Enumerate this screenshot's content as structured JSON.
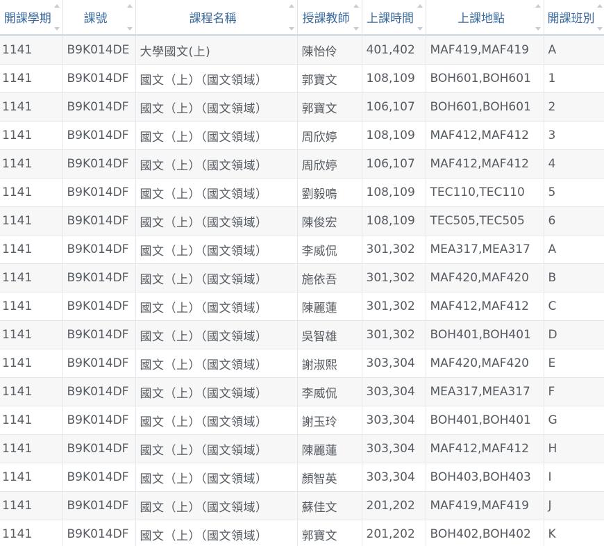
{
  "table": {
    "headers": [
      {
        "key": "semester",
        "label": "開課學期"
      },
      {
        "key": "code",
        "label": "課號"
      },
      {
        "key": "name",
        "label": "課程名稱"
      },
      {
        "key": "teacher",
        "label": "授課教師"
      },
      {
        "key": "time",
        "label": "上課時間"
      },
      {
        "key": "place",
        "label": "上課地點"
      },
      {
        "key": "class",
        "label": "開課班別"
      }
    ],
    "rows": [
      [
        "1141",
        "B9K014DE",
        "大學國文(上)",
        "陳怡伶",
        "401,402",
        "MAF419,MAF419",
        "A"
      ],
      [
        "1141",
        "B9K014DF",
        "國文（上）（國文領域）",
        "郭寶文",
        "108,109",
        "BOH601,BOH601",
        "1"
      ],
      [
        "1141",
        "B9K014DF",
        "國文（上）（國文領域）",
        "郭寶文",
        "106,107",
        "BOH601,BOH601",
        "2"
      ],
      [
        "1141",
        "B9K014DF",
        "國文（上）（國文領域）",
        "周欣婷",
        "108,109",
        "MAF412,MAF412",
        "3"
      ],
      [
        "1141",
        "B9K014DF",
        "國文（上）（國文領域）",
        "周欣婷",
        "106,107",
        "MAF412,MAF412",
        "4"
      ],
      [
        "1141",
        "B9K014DF",
        "國文（上）（國文領域）",
        "劉毅鳴",
        "108,109",
        "TEC110,TEC110",
        "5"
      ],
      [
        "1141",
        "B9K014DF",
        "國文（上）（國文領域）",
        "陳俊宏",
        "108,109",
        "TEC505,TEC505",
        "6"
      ],
      [
        "1141",
        "B9K014DF",
        "國文（上）（國文領域）",
        "李威侃",
        "301,302",
        "MEA317,MEA317",
        "A"
      ],
      [
        "1141",
        "B9K014DF",
        "國文（上）（國文領域）",
        "施依吾",
        "301,302",
        "MAF420,MAF420",
        "B"
      ],
      [
        "1141",
        "B9K014DF",
        "國文（上）（國文領域）",
        "陳麗蓮",
        "301,302",
        "MAF412,MAF412",
        "C"
      ],
      [
        "1141",
        "B9K014DF",
        "國文（上）（國文領域）",
        "吳智雄",
        "301,302",
        "BOH401,BOH401",
        "D"
      ],
      [
        "1141",
        "B9K014DF",
        "國文（上）（國文領域）",
        "謝淑熙",
        "303,304",
        "MAF420,MAF420",
        "E"
      ],
      [
        "1141",
        "B9K014DF",
        "國文（上）（國文領域）",
        "李威侃",
        "303,304",
        "MEA317,MEA317",
        "F"
      ],
      [
        "1141",
        "B9K014DF",
        "國文（上）（國文領域）",
        "謝玉玲",
        "303,304",
        "BOH401,BOH401",
        "G"
      ],
      [
        "1141",
        "B9K014DF",
        "國文（上）（國文領域）",
        "陳麗蓮",
        "303,304",
        "MAF412,MAF412",
        "H"
      ],
      [
        "1141",
        "B9K014DF",
        "國文（上）（國文領域）",
        "顏智英",
        "303,304",
        "BOH403,BOH403",
        "I"
      ],
      [
        "1141",
        "B9K014DF",
        "國文（上）（國文領域）",
        "蘇佳文",
        "201,202",
        "MAF419,MAF419",
        "J"
      ],
      [
        "1141",
        "B9K014DF",
        "國文（上）（國文領域）",
        "郭寶文",
        "201,202",
        "BOH402,BOH402",
        "K"
      ]
    ]
  },
  "colors": {
    "header_text": "#3a6a9e",
    "cell_text": "#555b61",
    "row_stripe": "#f7f7f8",
    "border": "#e3e6ea"
  }
}
